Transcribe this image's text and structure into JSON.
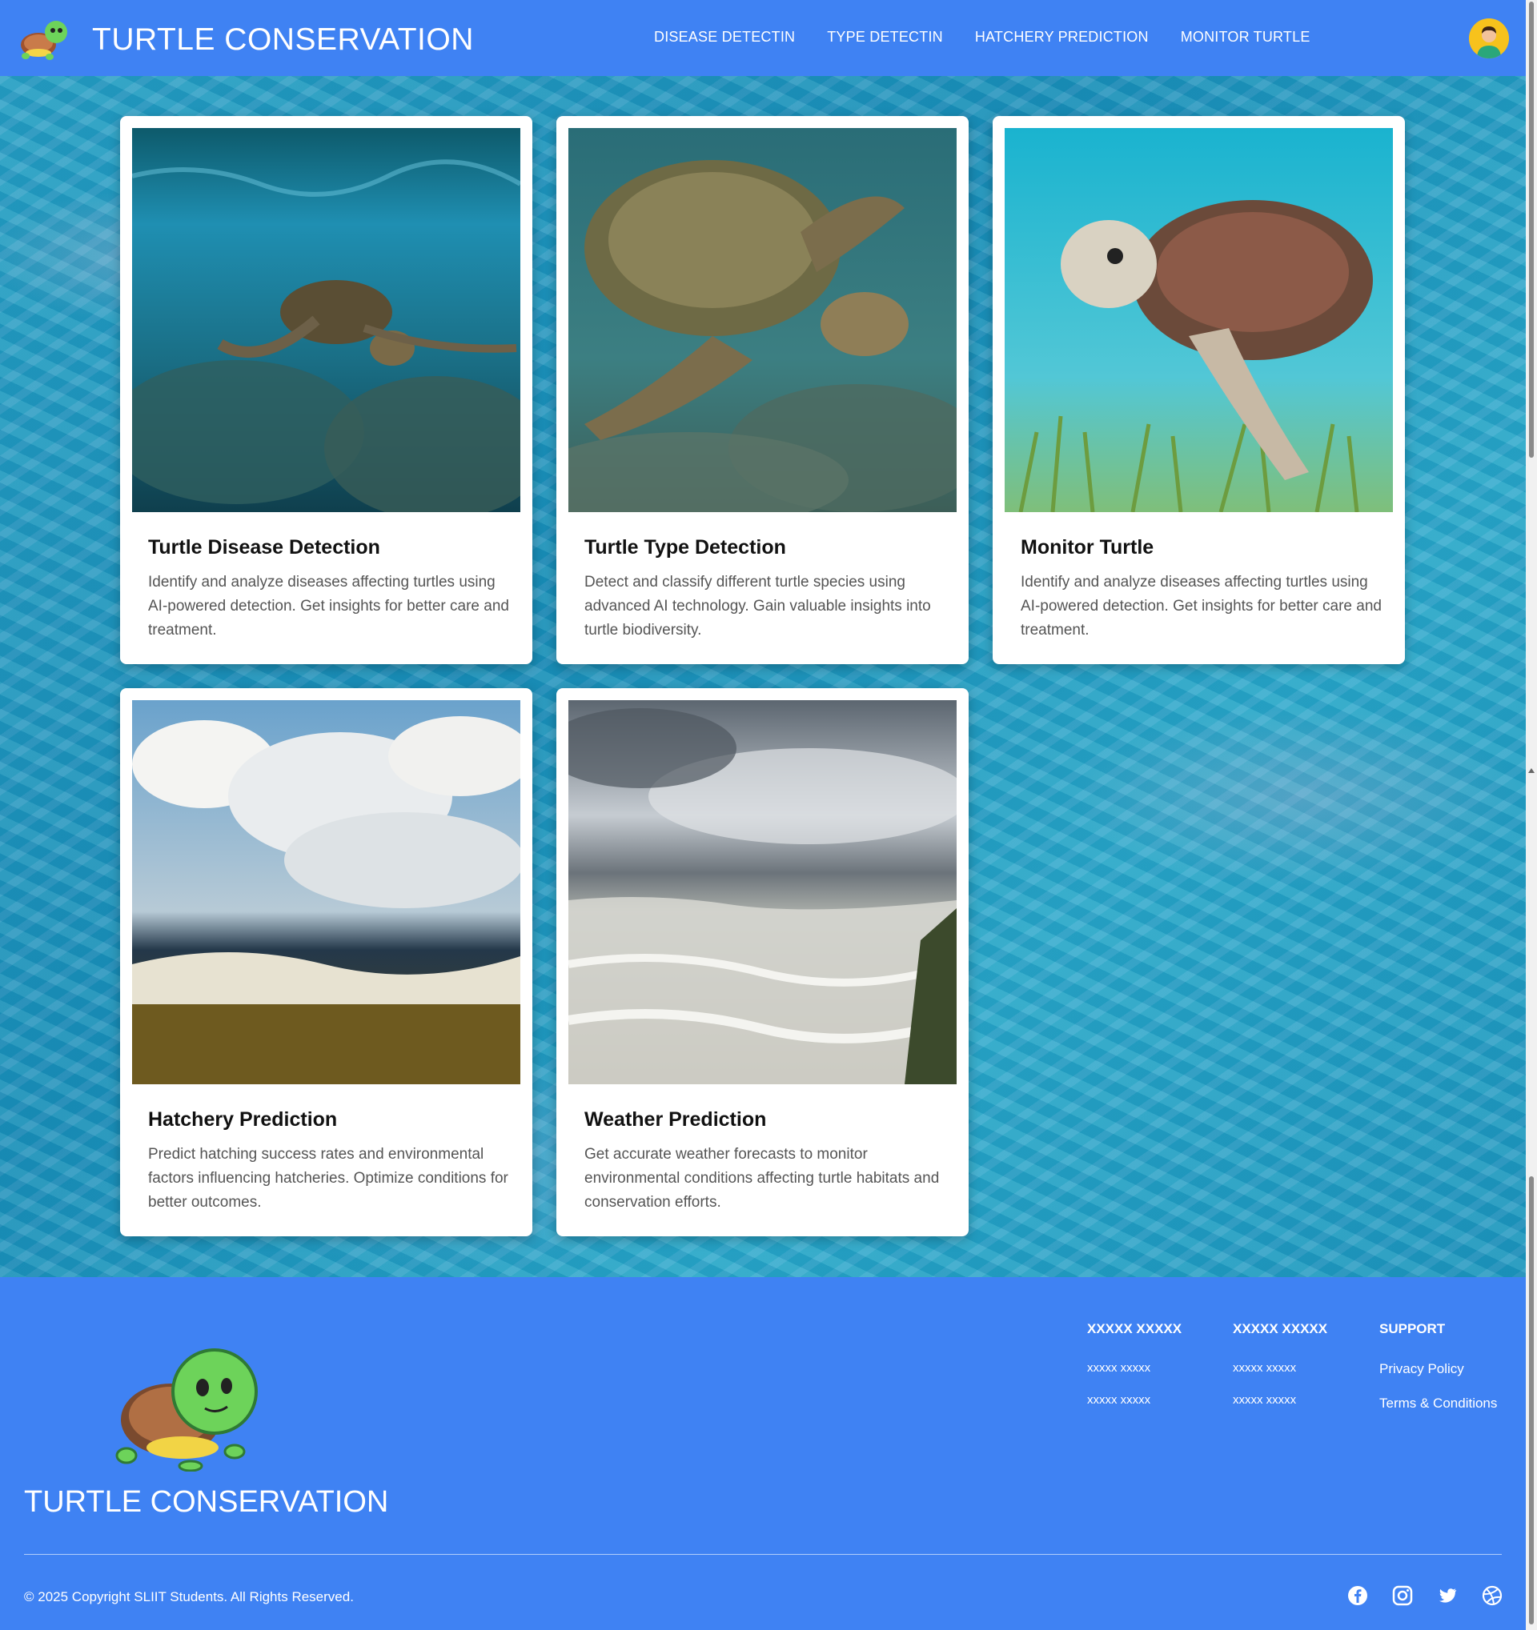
{
  "header": {
    "brand": "TURTLE CONSERVATION",
    "nav": [
      {
        "label": "DISEASE DETECTIN"
      },
      {
        "label": "TYPE DETECTIN"
      },
      {
        "label": "HATCHERY PREDICTION"
      },
      {
        "label": "MONITOR TURTLE"
      }
    ],
    "logo_icon": "turtle-logo-icon",
    "avatar_icon": "user-avatar-icon"
  },
  "cards": [
    {
      "title": "Turtle Disease Detection",
      "description": "Identify and analyze diseases affecting turtles using AI-powered detection. Get insights for better care and treatment.",
      "image": "sea-turtle-swimming-near-reef"
    },
    {
      "title": "Turtle Type Detection",
      "description": "Detect and classify different turtle species using advanced AI technology. Gain valuable insights into turtle biodiversity.",
      "image": "sea-turtle-closeup-underwater"
    },
    {
      "title": "Monitor Turtle",
      "description": "Identify and analyze diseases affecting turtles using AI-powered detection. Get insights for better care and treatment.",
      "image": "sea-turtle-over-seagrass"
    },
    {
      "title": "Hatchery Prediction",
      "description": "Predict hatching success rates and environmental factors influencing hatcheries. Optimize conditions for better outcomes.",
      "image": "clouds-over-ocean-waves"
    },
    {
      "title": "Weather Prediction",
      "description": "Get accurate weather forecasts to monitor environmental conditions affecting turtle habitats and conservation efforts.",
      "image": "stormy-sea-shore"
    }
  ],
  "footer": {
    "brand": "TURTLE CONSERVATION",
    "columns": [
      {
        "head": "XXXXX XXXXX",
        "links": [
          "xxxxx xxxxx",
          "xxxxx xxxxx"
        ]
      },
      {
        "head": "XXXXX XXXXX",
        "links": [
          "xxxxx xxxxx",
          "xxxxx xxxxx"
        ]
      },
      {
        "head": "SUPPORT",
        "links": [
          "Privacy Policy",
          "Terms & Conditions"
        ]
      }
    ],
    "copyright": "© 2025 Copyright SLIIT Students. All Rights Reserved.",
    "socials": [
      "facebook-icon",
      "instagram-icon",
      "twitter-icon",
      "dribbble-icon"
    ]
  },
  "colors": {
    "primary": "#3f82f3",
    "ocean": "#1f9cc2"
  }
}
